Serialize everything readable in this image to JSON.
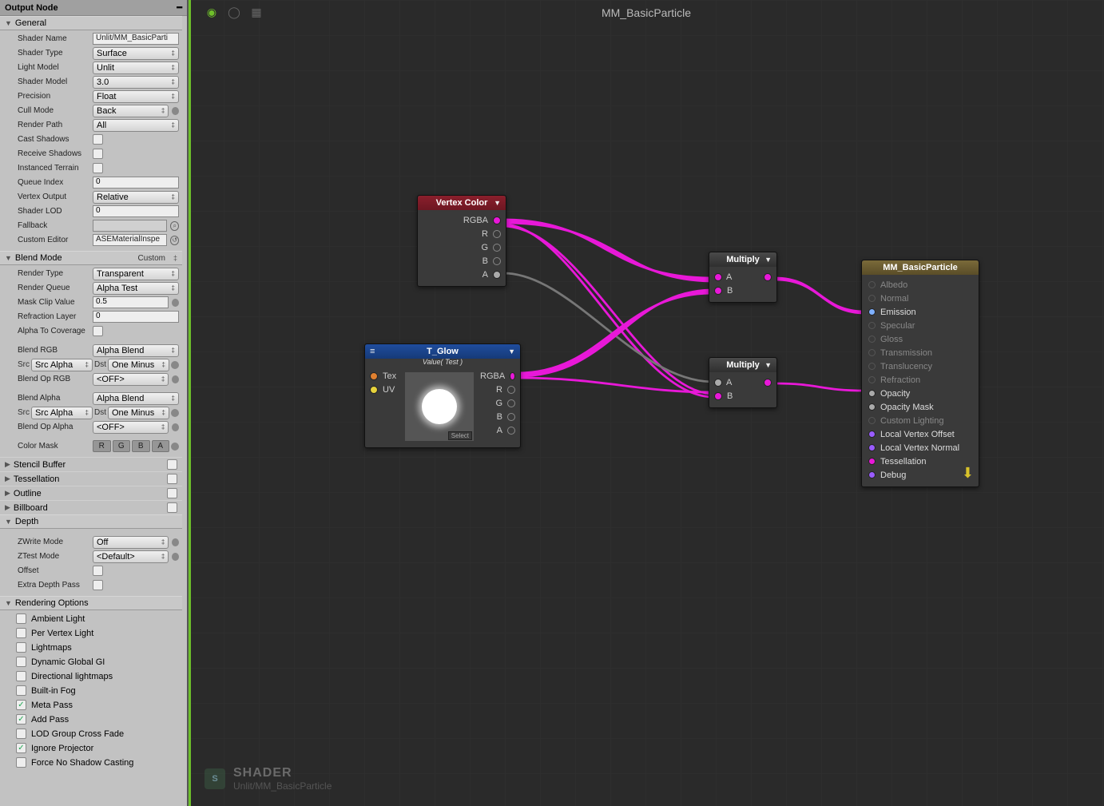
{
  "panel": {
    "title": "Output Node"
  },
  "general": {
    "header": "General",
    "shader_name_label": "Shader Name",
    "shader_name": "Unlit/MM_BasicParti",
    "shader_type_label": "Shader Type",
    "shader_type": "Surface",
    "light_model_label": "Light Model",
    "light_model": "Unlit",
    "shader_model_label": "Shader Model",
    "shader_model": "3.0",
    "precision_label": "Precision",
    "precision": "Float",
    "cull_mode_label": "Cull Mode",
    "cull_mode": "Back",
    "render_path_label": "Render Path",
    "render_path": "All",
    "cast_shadows_label": "Cast Shadows",
    "receive_shadows_label": "Receive Shadows",
    "instanced_terrain_label": "Instanced Terrain",
    "queue_index_label": "Queue Index",
    "queue_index": "0",
    "vertex_output_label": "Vertex Output",
    "vertex_output": "Relative",
    "shader_lod_label": "Shader LOD",
    "shader_lod": "0",
    "fallback_label": "Fallback",
    "fallback": "",
    "custom_editor_label": "Custom Editor",
    "custom_editor": "ASEMaterialInspe"
  },
  "blend": {
    "header": "Blend Mode",
    "mode_value": "Custom",
    "render_type_label": "Render Type",
    "render_type": "Transparent",
    "render_queue_label": "Render Queue",
    "render_queue": "Alpha Test",
    "mask_clip_label": "Mask Clip Value",
    "mask_clip": "0.5",
    "refraction_layer_label": "Refraction Layer",
    "refraction_layer": "0",
    "alpha_to_cov_label": "Alpha To Coverage",
    "blend_rgb_label": "Blend RGB",
    "blend_rgb": "Alpha Blend",
    "src_label": "Src",
    "dst_label": "Dst",
    "src_rgb": "Src Alpha",
    "dst_rgb": "One Minus",
    "blend_op_rgb_label": "Blend Op RGB",
    "blend_op_rgb": "<OFF>",
    "blend_alpha_label": "Blend Alpha",
    "blend_alpha": "Alpha Blend",
    "src_alpha": "Src Alpha",
    "dst_alpha": "One Minus",
    "blend_op_alpha_label": "Blend Op Alpha",
    "blend_op_alpha": "<OFF>",
    "color_mask_label": "Color Mask",
    "mask_r": "R",
    "mask_g": "G",
    "mask_b": "B",
    "mask_a": "A"
  },
  "foldouts": {
    "stencil": "Stencil Buffer",
    "tessellation": "Tessellation",
    "outline": "Outline",
    "billboard": "Billboard"
  },
  "depth": {
    "header": "Depth",
    "zwrite_label": "ZWrite Mode",
    "zwrite": "Off",
    "ztest_label": "ZTest Mode",
    "ztest": "<Default>",
    "offset_label": "Offset",
    "extra_label": "Extra Depth Pass"
  },
  "rendopts": {
    "header": "Rendering Options",
    "items": [
      {
        "label": "Ambient Light",
        "checked": false
      },
      {
        "label": "Per Vertex Light",
        "checked": false
      },
      {
        "label": "Lightmaps",
        "checked": false
      },
      {
        "label": "Dynamic Global GI",
        "checked": false
      },
      {
        "label": "Directional lightmaps",
        "checked": false
      },
      {
        "label": "Built-in Fog",
        "checked": false
      },
      {
        "label": "Meta Pass",
        "checked": true
      },
      {
        "label": "Add Pass",
        "checked": true
      },
      {
        "label": "LOD Group Cross Fade",
        "checked": false
      },
      {
        "label": "Ignore Projector",
        "checked": true
      },
      {
        "label": "Force No Shadow Casting",
        "checked": false
      }
    ]
  },
  "canvas": {
    "title": "MM_BasicParticle",
    "shader_word": "SHADER",
    "shader_path": "Unlit/MM_BasicParticle"
  },
  "nodes": {
    "vertex_color": {
      "title": "Vertex Color",
      "ports": [
        "RGBA",
        "R",
        "G",
        "B",
        "A"
      ]
    },
    "tglow": {
      "title": "T_Glow",
      "subtitle": "Value( Test )",
      "in_ports": [
        "Tex",
        "UV"
      ],
      "out_ports": [
        "RGBA",
        "R",
        "G",
        "B",
        "A"
      ],
      "select": "Select"
    },
    "mult_a": {
      "title": "Multiply",
      "in_ports": [
        "A",
        "B"
      ]
    },
    "mult_b": {
      "title": "Multiply",
      "in_ports": [
        "A",
        "B"
      ]
    },
    "output": {
      "title": "MM_BasicParticle",
      "ports": [
        {
          "label": "Albedo",
          "active": false,
          "color": ""
        },
        {
          "label": "Normal",
          "active": false,
          "color": ""
        },
        {
          "label": "Emission",
          "active": true,
          "color": "cyan"
        },
        {
          "label": "Specular",
          "active": false,
          "color": ""
        },
        {
          "label": "Gloss",
          "active": false,
          "color": ""
        },
        {
          "label": "Transmission",
          "active": false,
          "color": ""
        },
        {
          "label": "Translucency",
          "active": false,
          "color": ""
        },
        {
          "label": "Refraction",
          "active": false,
          "color": ""
        },
        {
          "label": "Opacity",
          "active": true,
          "color": "grey"
        },
        {
          "label": "Opacity Mask",
          "active": true,
          "color": "grey"
        },
        {
          "label": "Custom Lighting",
          "active": false,
          "color": ""
        },
        {
          "label": "Local Vertex Offset",
          "active": true,
          "color": "purple"
        },
        {
          "label": "Local Vertex Normal",
          "active": true,
          "color": "purple"
        },
        {
          "label": "Tessellation",
          "active": true,
          "color": "magenta"
        },
        {
          "label": "Debug",
          "active": true,
          "color": "purple"
        }
      ]
    }
  }
}
